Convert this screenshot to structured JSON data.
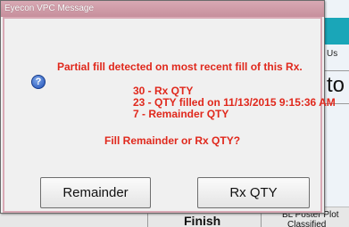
{
  "background": {
    "partial_label": "Us",
    "partial_heading": "to",
    "finish_label": "Finish",
    "plot_label": "BL Poster Plot",
    "classified_label": "Classified"
  },
  "dialog": {
    "title": "Eyecon VPC Message",
    "icon": "info-icon",
    "message_line1": "Partial fill detected on most recent fill of this Rx.",
    "rx_qty_line": "30  - Rx QTY",
    "filled_line": "23  - QTY filled on 11/13/2015 9:15:36 AM",
    "remainder_line": "7   - Remainder QTY",
    "question": "Fill Remainder or Rx QTY?",
    "remainder_button": "Remainder",
    "rxqty_button": "Rx QTY",
    "colors": {
      "message_text": "#e0281c",
      "title_bar": "#c78f9c",
      "border": "#d9a9b5"
    }
  }
}
